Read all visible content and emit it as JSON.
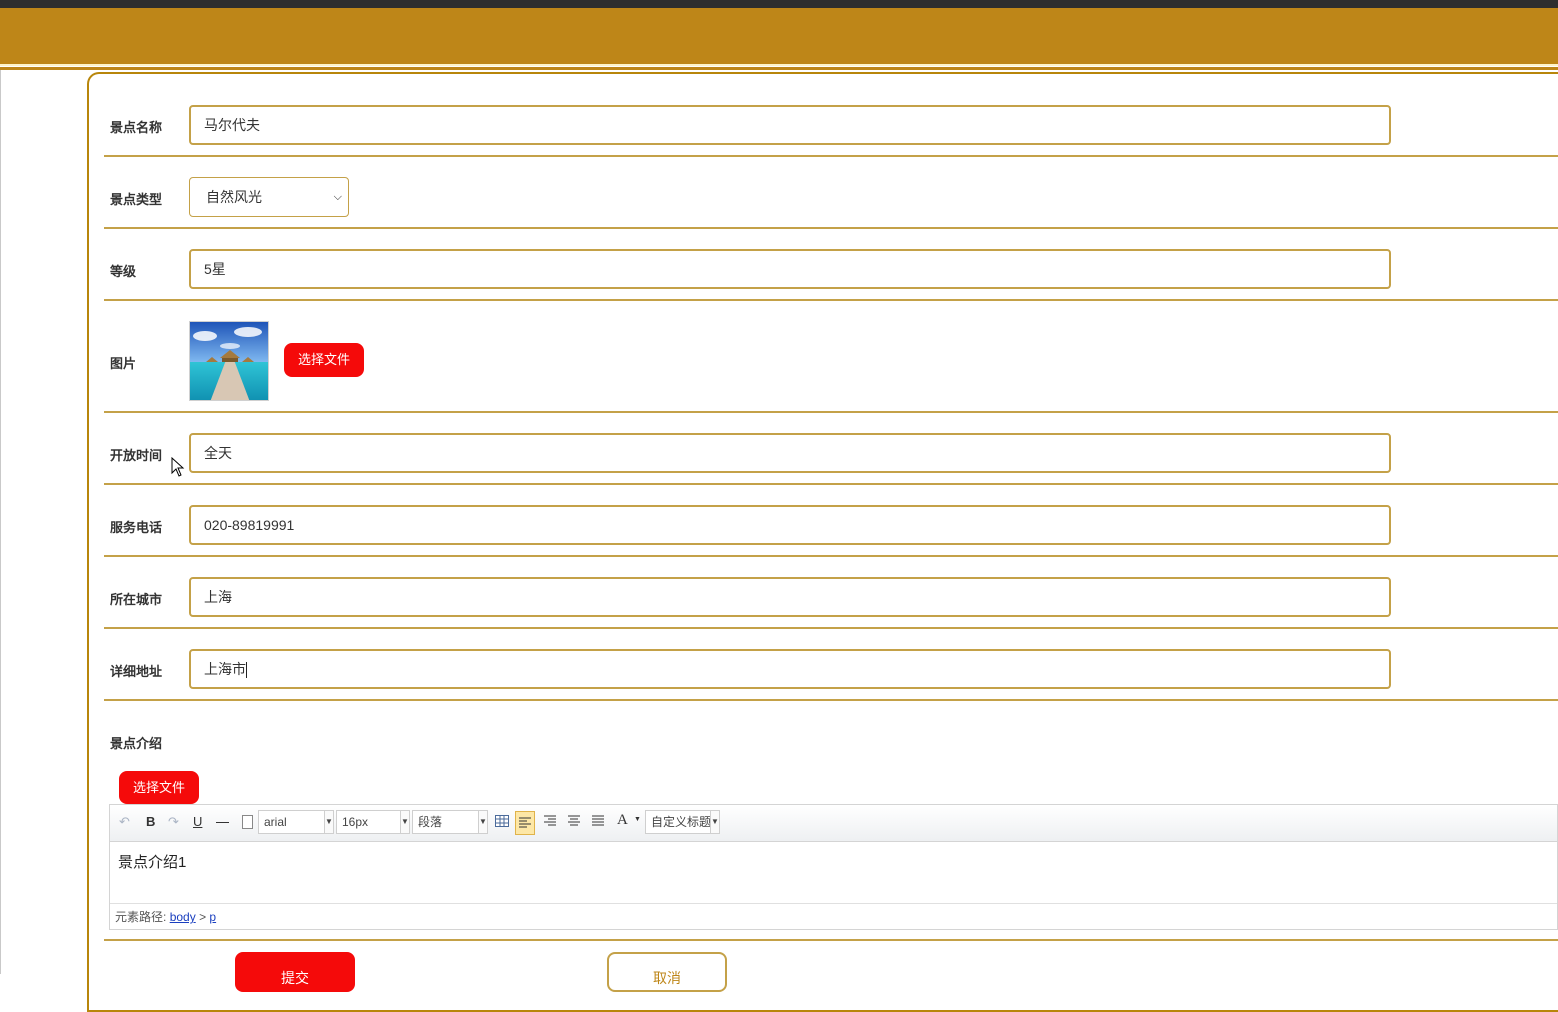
{
  "form": {
    "name": {
      "label": "景点名称",
      "value": "马尔代夫"
    },
    "type": {
      "label": "景点类型",
      "value": "自然风光"
    },
    "level": {
      "label": "等级",
      "value": "5星"
    },
    "picture": {
      "label": "图片",
      "button": "选择文件"
    },
    "open_time": {
      "label": "开放时间",
      "value": "全天"
    },
    "phone": {
      "label": "服务电话",
      "value": "020-89819991"
    },
    "city": {
      "label": "所在城市",
      "value": "上海"
    },
    "address": {
      "label": "详细地址",
      "value": "上海市"
    },
    "intro": {
      "label": "景点介绍",
      "button": "选择文件",
      "toolbar": {
        "bold": "B",
        "underline": "U",
        "font_family": "arial",
        "font_size": "16px",
        "paragraph": "段落",
        "font_color": "A",
        "custom_title": "自定义标题"
      },
      "content": "景点介绍1",
      "path_label": "元素路径:",
      "path_body": "body",
      "path_sep": ">",
      "path_p": "p"
    },
    "submit": "提交",
    "cancel": "取消"
  },
  "colors": {
    "header": "#be8618",
    "border": "#c4a148",
    "button_red": "#f50a0a"
  }
}
